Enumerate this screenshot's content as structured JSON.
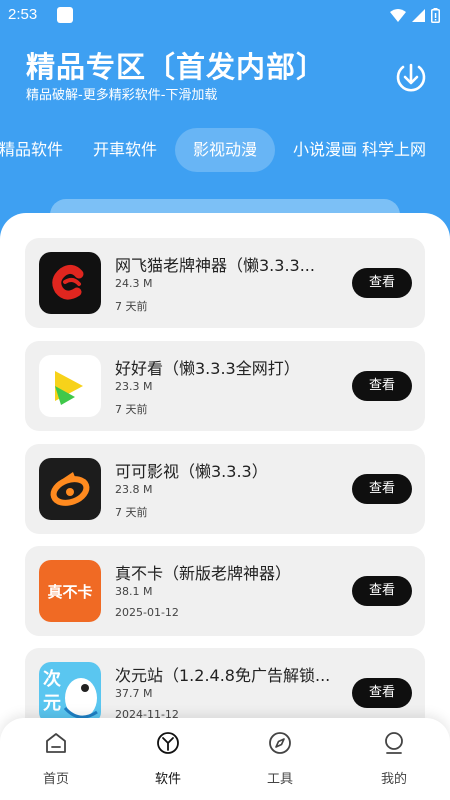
{
  "status_bar": {
    "time": "2:53"
  },
  "header": {
    "title": "精品专区〔首发内部〕",
    "subtitle": "精品破解-更多精彩软件-下滑加载",
    "download_icon": "download-icon"
  },
  "tabs": [
    {
      "label": "精品软件",
      "active": false
    },
    {
      "label": "开車软件",
      "active": false
    },
    {
      "label": "影视动漫",
      "active": true
    },
    {
      "label": "小说漫画",
      "active": false
    },
    {
      "label": "科学上网",
      "active": false
    }
  ],
  "apps": [
    {
      "name": "网飞猫老牌神器（懒3.3.3...",
      "size": "24.3 M",
      "date": "7 天前",
      "button": "查看",
      "icon_color": "#111111",
      "accent": "#e0261f"
    },
    {
      "name": "好好看（懒3.3.3全网打）",
      "size": "23.3 M",
      "date": "7 天前",
      "button": "查看",
      "icon_color": "#ffffff",
      "accent": "#f7d21a"
    },
    {
      "name": "可可影视（懒3.3.3）",
      "size": "23.8 M",
      "date": "7 天前",
      "button": "查看",
      "icon_color": "#1c1c1c",
      "accent": "#ff8a1f"
    },
    {
      "name": "真不卡（新版老牌神器）",
      "size": "38.1 M",
      "date": "2025-01-12",
      "button": "查看",
      "icon_color": "#f06a24",
      "accent": "#ffffff"
    },
    {
      "name": "次元站（1.2.4.8免广告解锁...",
      "size": "37.7 M",
      "date": "2024-11-12",
      "button": "查看",
      "icon_color": "#5ac6f0",
      "accent": "#ffffff"
    }
  ],
  "icon_texts": {
    "zhenbuka": "真不卡",
    "ciyuanzhan": "次元"
  },
  "bottom_nav": [
    {
      "label": "首页",
      "icon": "home-icon",
      "active": false
    },
    {
      "label": "软件",
      "icon": "software-icon",
      "active": true
    },
    {
      "label": "工具",
      "icon": "compass-icon",
      "active": false
    },
    {
      "label": "我的",
      "icon": "profile-icon",
      "active": false
    }
  ],
  "colors": {
    "header_bg": "#3ea0f2",
    "card_bg": "#f0f0f0",
    "button_bg": "#0f0f0f"
  }
}
